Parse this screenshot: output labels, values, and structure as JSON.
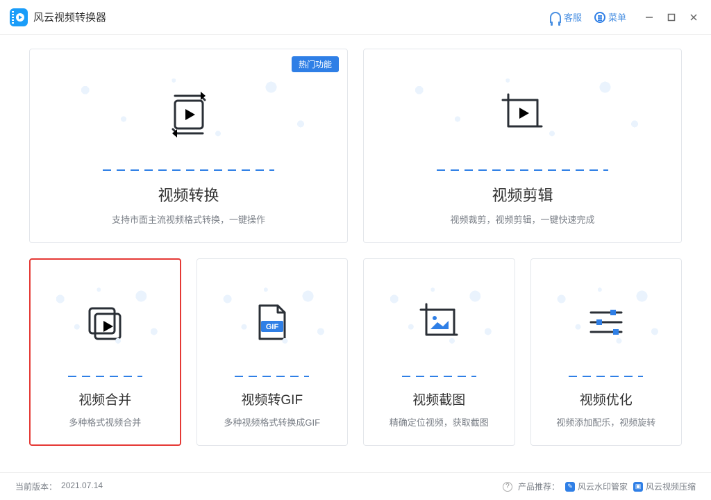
{
  "header": {
    "title": "风云视频转换器",
    "service_label": "客服",
    "menu_label": "菜单"
  },
  "cards": {
    "convert": {
      "badge": "热门功能",
      "title": "视频转换",
      "desc": "支持市面主流视频格式转换，一键操作"
    },
    "edit": {
      "title": "视频剪辑",
      "desc": "视频裁剪，视频剪辑，一键快速完成"
    },
    "merge": {
      "title": "视频合并",
      "desc": "多种格式视频合并"
    },
    "gif": {
      "title": "视频转GIF",
      "desc": "多种视频格式转换成GIF",
      "gif_label": "GIF"
    },
    "screenshot": {
      "title": "视频截图",
      "desc": "精确定位视频，获取截图"
    },
    "optimize": {
      "title": "视频优化",
      "desc": "视频添加配乐，视频旋转"
    }
  },
  "footer": {
    "version_label": "当前版本：",
    "version_value": "2021.07.14",
    "recommend_label": "产品推荐：",
    "rec1": "风云水印管家",
    "rec2": "风云视频压缩"
  }
}
